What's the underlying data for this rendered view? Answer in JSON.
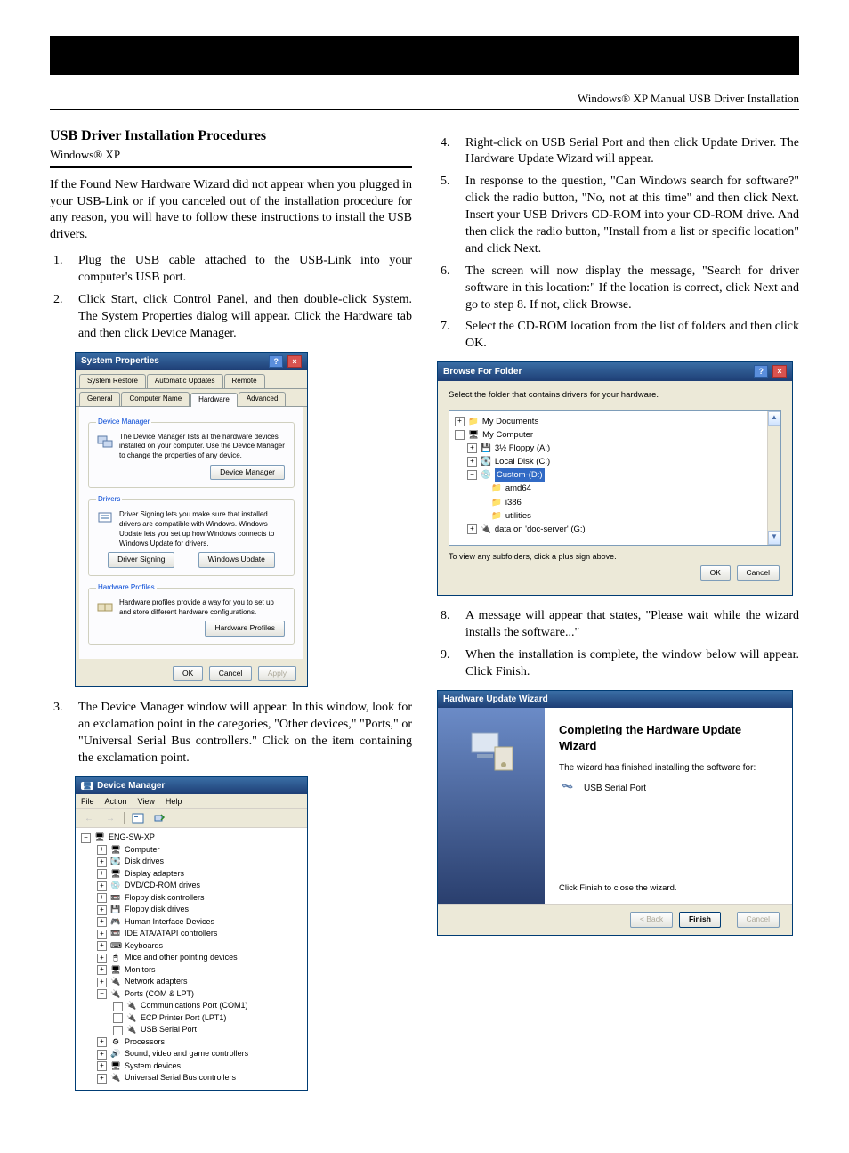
{
  "header": {
    "sub_right": "Windows® XP Manual USB Driver Installation"
  },
  "left": {
    "section_title": "USB Driver Installation Procedures",
    "section_sub": "Windows® XP",
    "intro": "If the Found New Hardware Wizard did not appear when you plugged in your USB-Link or if you canceled out of the installation procedure for any reason, you will have to follow these instructions to install the USB drivers.",
    "step1": "Plug the USB cable attached to the USB-Link into your computer's USB port.",
    "step2": "Click Start, click Control Panel, and then double-click System. The System Properties dialog will appear. Click the Hardware tab and then click Device Manager.",
    "step3": "The Device Manager window will appear. In this window, look for an exclamation point in the categories, \"Other devices,\" \"Ports,\" or \"Universal Serial Bus controllers.\" Click on the item containing the exclamation point."
  },
  "right": {
    "step4": "Right-click on USB Serial Port and then click Update Driver. The Hardware Update Wizard will appear.",
    "step5": "In response to the question, \"Can Windows search for software?\" click the radio button, \"No, not at this time\" and then click Next. Insert your USB Drivers CD-ROM into your CD-ROM drive. And then click the radio button, \"Install from a list or specific location\" and click Next.",
    "step6": "The screen will now display the message, \"Search for driver software in this location:\" If the location is correct, click Next and go to step 8. If not, click Browse.",
    "step7": "Select the CD-ROM location from the list of folders and then click OK.",
    "step8": "A message will appear that states, \"Please wait while the wizard installs the software...\"",
    "step9": "When the installation is complete, the window below will appear. Click Finish."
  },
  "sysProperties": {
    "title": "System Properties",
    "tabs_row1": [
      "System Restore",
      "Automatic Updates",
      "Remote"
    ],
    "tabs_row2": [
      "General",
      "Computer Name",
      "Hardware",
      "Advanced"
    ],
    "group_devmgr": {
      "legend": "Device Manager",
      "text": "The Device Manager lists all the hardware devices installed on your computer. Use the Device Manager to change the properties of any device.",
      "btn": "Device Manager"
    },
    "group_drivers": {
      "legend": "Drivers",
      "text": "Driver Signing lets you make sure that installed drivers are compatible with Windows. Windows Update lets you set up how Windows connects to Windows Update for drivers.",
      "btn1": "Driver Signing",
      "btn2": "Windows Update"
    },
    "group_hwprofiles": {
      "legend": "Hardware Profiles",
      "text": "Hardware profiles provide a way for you to set up and store different hardware configurations.",
      "btn": "Hardware Profiles"
    },
    "btn_ok": "OK",
    "btn_cancel": "Cancel",
    "btn_apply": "Apply"
  },
  "deviceManager": {
    "title": "Device Manager",
    "menus": [
      "File",
      "Action",
      "View",
      "Help"
    ],
    "root": "ENG-SW-XP",
    "items": [
      "Computer",
      "Disk drives",
      "Display adapters",
      "DVD/CD-ROM drives",
      "Floppy disk controllers",
      "Floppy disk drives",
      "Human Interface Devices",
      "IDE ATA/ATAPI controllers",
      "Keyboards",
      "Mice and other pointing devices",
      "Monitors",
      "Network adapters",
      "Ports (COM & LPT)"
    ],
    "ports_children": [
      "Communications Port (COM1)",
      "ECP Printer Port (LPT1)",
      "USB Serial Port"
    ],
    "items_after": [
      "Processors",
      "Sound, video and game controllers",
      "System devices",
      "Universal Serial Bus controllers"
    ]
  },
  "browseFolder": {
    "title": "Browse For Folder",
    "prompt": "Select the folder that contains drivers for your hardware.",
    "tree": {
      "my_documents": "My Documents",
      "my_computer": "My Computer",
      "floppy": "3½ Floppy (A:)",
      "localc": "Local Disk (C:)",
      "customd": "Custom-(D:)",
      "amd64": "amd64",
      "i386": "i386",
      "utilities": "utilities",
      "datag": "data on 'doc-server' (G:)"
    },
    "hint": "To view any subfolders, click a plus sign above.",
    "btn_ok": "OK",
    "btn_cancel": "Cancel"
  },
  "wizard": {
    "title": "Hardware Update Wizard",
    "heading": "Completing the Hardware Update Wizard",
    "sub": "The wizard has finished installing the software for:",
    "item": "USB Serial Port",
    "closer": "Click Finish to close the wizard.",
    "btn_back": "< Back",
    "btn_finish": "Finish",
    "btn_cancel": "Cancel"
  }
}
